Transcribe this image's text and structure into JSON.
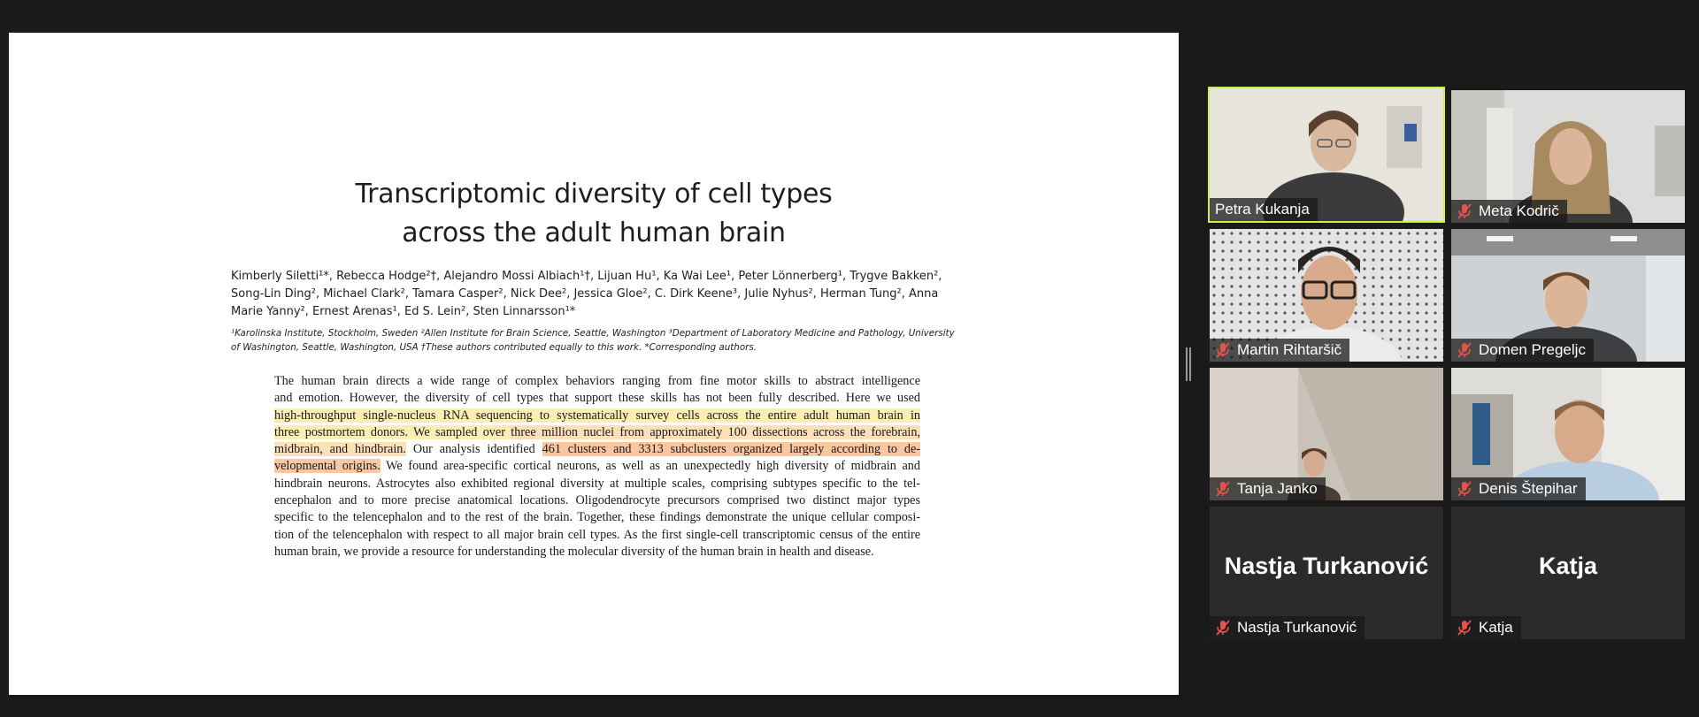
{
  "slide": {
    "title_lines": [
      "Transcriptomic diversity of cell types",
      "across the adult human brain"
    ],
    "authors_lines": [
      "Kimberly Siletti¹*, Rebecca Hodge²†, Alejandro Mossi Albiach¹†, Lijuan Hu¹, Ka Wai Lee¹, Peter Lönnerberg¹, Trygve Bakken²,",
      "Song-Lin Ding², Michael Clark², Tamara Casper², Nick Dee², Jessica Gloe², C. Dirk Keene³, Julie Nyhus², Herman Tung², Anna",
      "Marie Yanny², Ernest Arenas¹, Ed S. Lein², Sten Linnarsson¹*"
    ],
    "affiliation_lines": [
      "¹Karolinska Institute, Stockholm, Sweden ²Allen Institute for Brain Science, Seattle, Washington ³Department of Laboratory Medicine and Pathology, University",
      "of Washington, Seattle, Washington, USA †These authors contributed equally to this work. *Corresponding authors."
    ],
    "abstract": {
      "l1": "The human brain directs a wide range of complex behaviors ranging from fine motor skills to abstract intelligence",
      "l2": "and emotion. However, the diversity of cell types that support these skills has not been fully described. Here we used",
      "l3": "high-throughput single-nucleus RNA sequencing to systematically survey cells across the entire adult human brain in",
      "l4a": "three postmortem donors. We sampled over ",
      "l4b": "three million nuclei from approximately 100 dissections across the forebrain,",
      "l5a": "midbrain, and hindbrain.",
      "l5b": " Our analysis identified ",
      "l5c": "461 clusters and 3313 subclusters organized largely according to de-",
      "l6a": "velopmental origins.",
      "l6b": " We found area-specific cortical neurons, as well as an unexpectedly high diversity of midbrain and",
      "l7": "hindbrain neurons. Astrocytes also exhibited regional diversity at multiple scales, comprising subtypes specific to the tel-",
      "l8": "encephalon and to more precise anatomical locations. Oligodendrocyte precursors comprised two distinct major types",
      "l9": "specific to the telencephalon and to the rest of the brain. Together, these findings demonstrate the unique cellular composi-",
      "l10": "tion of the telencephalon with respect to all major brain cell types. As the first single-cell transcriptomic census of the entire",
      "l11": "human brain, we provide a resource for understanding the molecular diversity of the human brain in health and disease."
    },
    "highlight_colors": {
      "yellow": "#fbedb4",
      "orange": "#f9c7a1"
    }
  },
  "participants": [
    {
      "name": "Petra Kukanja",
      "muted": false,
      "video": true,
      "active_speaker": true
    },
    {
      "name": "Meta Kodrič",
      "muted": true,
      "video": true,
      "active_speaker": false
    },
    {
      "name": "Martin Rihtaršič",
      "muted": true,
      "video": true,
      "active_speaker": false
    },
    {
      "name": "Domen Pregeljc",
      "muted": true,
      "video": true,
      "active_speaker": false
    },
    {
      "name": "Tanja Janko",
      "muted": true,
      "video": true,
      "active_speaker": false
    },
    {
      "name": "Denis Štepihar",
      "muted": true,
      "video": true,
      "active_speaker": false
    },
    {
      "name": "Nastja Turkanović",
      "muted": true,
      "video": false,
      "active_speaker": false
    },
    {
      "name": "Katja",
      "muted": true,
      "video": false,
      "active_speaker": false
    }
  ],
  "colors": {
    "background": "#1a1a1a",
    "active_speaker_border": "#c5f04f",
    "muted_icon": "#e5534b"
  },
  "icons": {
    "muted": "mic-muted-icon",
    "divider": "drag-handle-icon"
  }
}
